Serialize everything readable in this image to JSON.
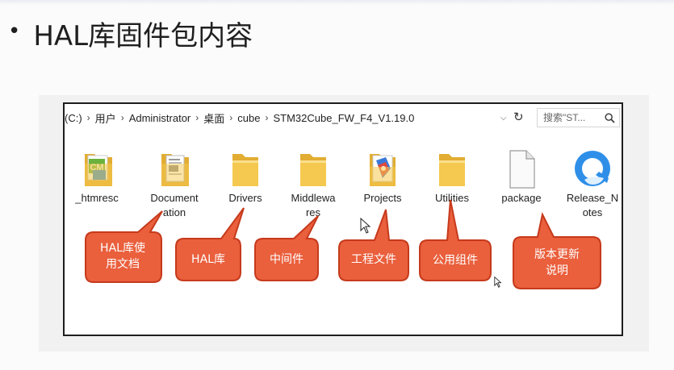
{
  "slide": {
    "bullet": "•",
    "title": "HAL库固件包内容"
  },
  "explorer": {
    "breadcrumbs": [
      "(C:)",
      "用户",
      "Administrator",
      "桌面",
      "cube",
      "STM32Cube_FW_F4_V1.19.0"
    ],
    "breadcrumb_separator": "›",
    "dropdown_glyph": "⌵",
    "refresh_glyph": "↻",
    "search_placeholder": "搜索\"ST...",
    "items": [
      {
        "label": "_htmresc",
        "icon": "html-resource-folder-icon"
      },
      {
        "label": "Documentation",
        "display": "Document\nation",
        "icon": "document-folder-icon"
      },
      {
        "label": "Drivers",
        "icon": "folder-icon"
      },
      {
        "label": "Middlewares",
        "display": "Middlewa\nres",
        "icon": "folder-icon"
      },
      {
        "label": "Projects",
        "icon": "projects-folder-icon"
      },
      {
        "label": "Utilities",
        "icon": "folder-icon"
      },
      {
        "label": "package",
        "icon": "file-icon"
      },
      {
        "label": "Release_Notes",
        "display": "Release_N\notes",
        "icon": "browser-icon"
      }
    ]
  },
  "callouts": [
    {
      "text": "HAL库使\n用文档"
    },
    {
      "text": "HAL库"
    },
    {
      "text": "中间件"
    },
    {
      "text": "工程文件"
    },
    {
      "text": "公用组件"
    },
    {
      "text": "版本更新\n说明"
    }
  ],
  "colors": {
    "callout_fill": "#ea5f3c",
    "callout_stroke": "#c63a1c",
    "folder": "#f2c44d"
  }
}
